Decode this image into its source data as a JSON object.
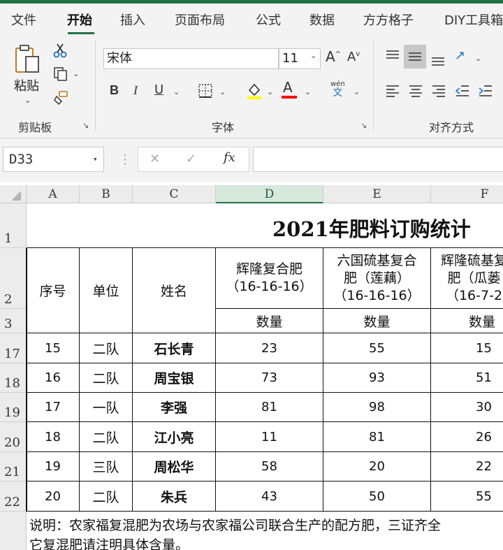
{
  "ribbon_tabs": [
    "文件",
    "开始",
    "插入",
    "页面布局",
    "公式",
    "数据",
    "方方格子",
    "DIY工具箱"
  ],
  "clipboard": {
    "paste_label": "粘贴",
    "group_label": "剪贴板"
  },
  "font": {
    "name": "宋体",
    "size": "11",
    "bold": "B",
    "italic": "I",
    "underline": "U",
    "font_color_letter": "A",
    "phonetic_label": "wén",
    "phonetic_char": "文",
    "group_label": "字体",
    "grow_label": "A",
    "shrink_label": "A"
  },
  "alignment": {
    "group_label": "对齐方式"
  },
  "colors": {
    "accent": "#217346",
    "highlight": "#ffff00",
    "font_color": "#ff0000"
  },
  "formula_bar": {
    "name_box": "D33",
    "cancel": "✕",
    "enter": "✓",
    "fx": "fx",
    "formula": ""
  },
  "columns": [
    "A",
    "B",
    "C",
    "D",
    "E",
    "F"
  ],
  "rows": [
    "1",
    "2",
    "3",
    "17",
    "18",
    "19",
    "20",
    "21",
    "22"
  ],
  "table": {
    "title": "2021年肥料订购统计",
    "headers": {
      "seq": "序号",
      "unit": "单位",
      "name": "姓名"
    },
    "products": [
      "辉隆复合肥\n（16-16-16）",
      "六国硫基复合\n肥（莲藕）\n（16-16-16）",
      "辉隆硫基复\n肥（瓜蒌\n（16-7-2"
    ],
    "qty_label": "数量",
    "data": [
      [
        "15",
        "二队",
        "石长青",
        "23",
        "55",
        "15"
      ],
      [
        "16",
        "二队",
        "周宝银",
        "73",
        "93",
        "51"
      ],
      [
        "17",
        "一队",
        "李强",
        "81",
        "98",
        "30"
      ],
      [
        "18",
        "二队",
        "江小亮",
        "11",
        "81",
        "26"
      ],
      [
        "19",
        "三队",
        "周松华",
        "58",
        "20",
        "22"
      ],
      [
        "20",
        "二队",
        "朱兵",
        "43",
        "50",
        "55"
      ]
    ],
    "note": "说明：农家福复混肥为农场与农家福公司联合生产的配方肥，三证齐全",
    "note2": "它复混肥请注明具体含量。"
  }
}
